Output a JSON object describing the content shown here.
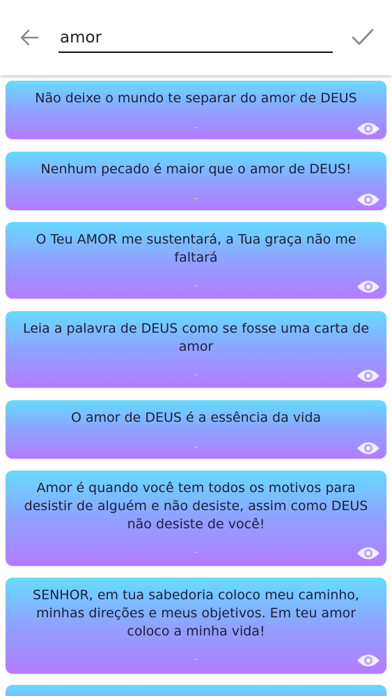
{
  "search": {
    "value": "amor",
    "back_icon": "arrow-left-icon",
    "confirm_icon": "check-icon"
  },
  "colors": {
    "card_top": "#67dbff",
    "card_bottom": "#b27cff",
    "text": "#1e1e3c",
    "author": "#ffd27a",
    "eye": "#ffffff"
  },
  "quotes": [
    {
      "text": "Não deixe o mundo te separar do amor de DEUS",
      "author": "-"
    },
    {
      "text": "Nenhum pecado é maior que o amor de DEUS!",
      "author": "-"
    },
    {
      "text": "O Teu AMOR me sustentará, a Tua graça não me faltará",
      "author": "-"
    },
    {
      "text": "Leia a palavra de DEUS como se fosse uma carta de amor",
      "author": "-"
    },
    {
      "text": "O amor de DEUS é a essência da vida",
      "author": "-"
    },
    {
      "text": "Amor é quando você tem todos os motivos para desistir de alguém e não desiste, assim como DEUS não desiste de você!",
      "author": "-"
    },
    {
      "text": "SENHOR, em tua sabedoria coloco meu caminho, minhas direções e meus objetivos. Em teu amor coloco a minha vida!",
      "author": "-"
    }
  ],
  "view_icon": "eye-icon"
}
